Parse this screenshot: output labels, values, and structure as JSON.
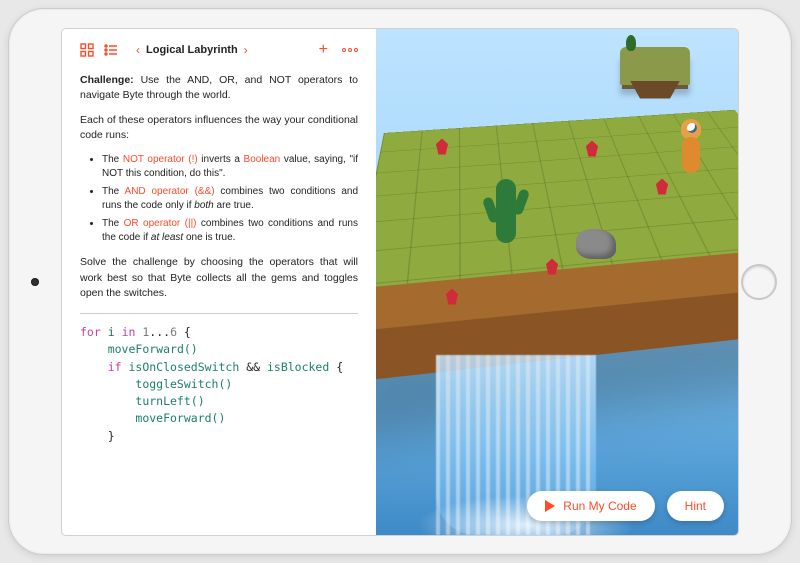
{
  "accent": "#ff4b2a",
  "header": {
    "title": "Logical Labyrinth"
  },
  "instructions": {
    "challenge_label": "Challenge:",
    "challenge_text": "Use the AND, OR, and NOT operators to navigate Byte through the world.",
    "intro": "Each of these operators influences the way your conditional code runs:",
    "bullets": [
      {
        "op": "NOT operator (!)",
        "pre": "The ",
        "mid1": " inverts a ",
        "kw2": "Boolean",
        "mid2": " value, saying, \"if NOT this condition, do this\"."
      },
      {
        "op": "AND operator (&&)",
        "pre": "The ",
        "mid1": " combines two conditions and runs the code only if ",
        "em": "both",
        "post": " are true."
      },
      {
        "op": "OR operator (||)",
        "pre": "The ",
        "mid1": " combines two conditions and runs the code if ",
        "em": "at least",
        "post": " one is true."
      }
    ],
    "outro": "Solve the challenge by choosing the operators that will work best so that Byte collects all the gems and toggles open the switches."
  },
  "code": {
    "lines": [
      {
        "t": "for ",
        "c": "tk-key",
        "rest": [
          {
            "t": "i",
            "c": "tk-id"
          },
          {
            "t": " in ",
            "c": "tk-key"
          },
          {
            "t": "1",
            "c": "tk-num"
          },
          {
            "t": "...",
            "c": ""
          },
          {
            "t": "6",
            "c": "tk-num"
          },
          {
            "t": " {",
            "c": ""
          }
        ]
      },
      {
        "indent": 1,
        "plain": "moveForward()",
        "c": "tk-fn"
      },
      {
        "indent": 1,
        "t": "if ",
        "c": "tk-key",
        "rest": [
          {
            "t": "isOnClosedSwitch",
            "c": "tk-fn"
          },
          {
            "t": " && ",
            "c": ""
          },
          {
            "t": "isBlocked",
            "c": "tk-fn"
          },
          {
            "t": " {",
            "c": ""
          }
        ]
      },
      {
        "indent": 2,
        "plain": "toggleSwitch()",
        "c": "tk-fn"
      },
      {
        "indent": 2,
        "plain": "turnLeft()",
        "c": "tk-fn"
      },
      {
        "indent": 2,
        "plain": "moveForward()",
        "c": "tk-fn"
      },
      {
        "indent": 1,
        "plain": "}",
        "c": ""
      }
    ]
  },
  "actions": {
    "run": "Run My Code",
    "hint": "Hint"
  },
  "icons": {
    "grid": "grid-icon",
    "list": "list-icon",
    "prev": "chevron-left-icon",
    "next": "chevron-right-icon",
    "add": "plus-icon",
    "more": "more-icon"
  }
}
